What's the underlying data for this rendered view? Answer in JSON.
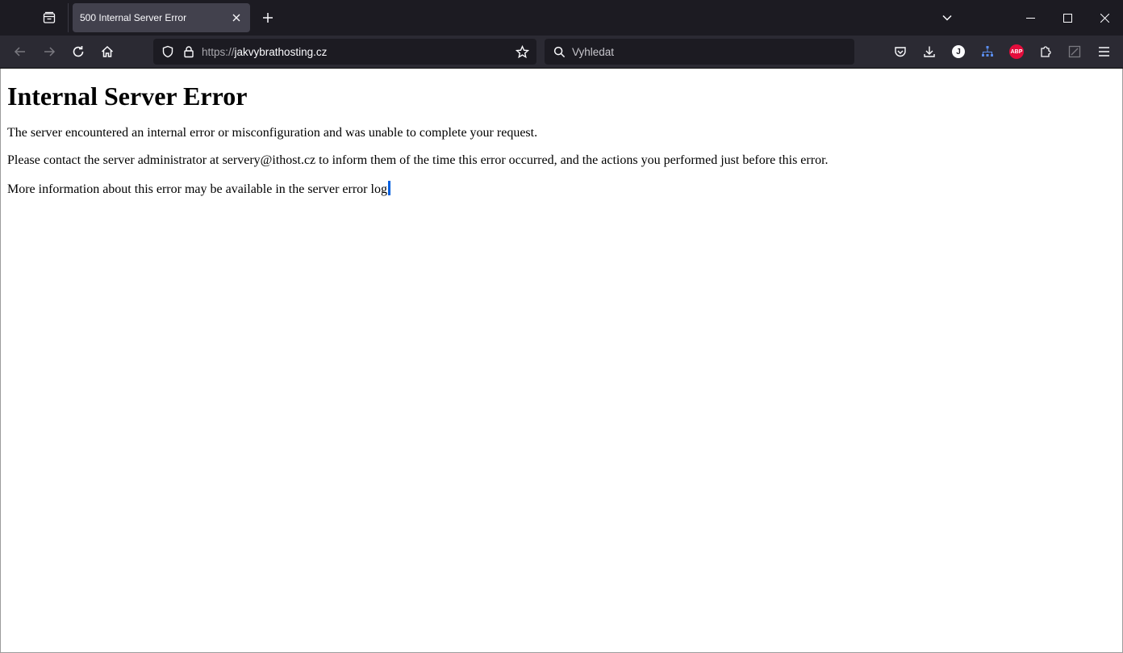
{
  "browser": {
    "tab": {
      "title": "500 Internal Server Error",
      "close_icon": "close-icon"
    },
    "url": {
      "protocol": "https://",
      "host": "jakvybrathosting.cz"
    },
    "search": {
      "placeholder": "Vyhledat"
    },
    "toolbar": {
      "profile_initial": "J",
      "adblock_label": "ABP"
    },
    "colors": {
      "tabbar_bg": "#1c1b22",
      "toolbar_bg": "#2b2a33",
      "active_tab_bg": "#42414d",
      "abp_red": "#e40d3c",
      "caret_blue": "#0060df"
    }
  },
  "page": {
    "heading": "Internal Server Error",
    "paragraph1": "The server encountered an internal error or misconfiguration and was unable to complete your request.",
    "paragraph2": "Please contact the server administrator at servery@ithost.cz to inform them of the time this error occurred, and the actions you performed just before this error.",
    "paragraph3": "More information about this error may be available in the server error log."
  }
}
